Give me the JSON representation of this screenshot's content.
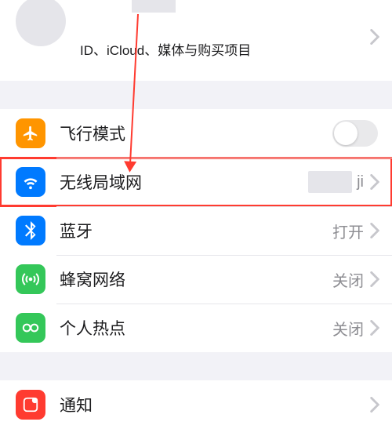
{
  "profile": {
    "subtitle": "ID、iCloud、媒体与购买项目"
  },
  "icons": {
    "airplane": "airplane-icon",
    "wifi": "wifi-icon",
    "bluetooth": "bluetooth-icon",
    "cellular": "cellular-icon",
    "hotspot": "hotspot-icon",
    "notifications": "notifications-icon"
  },
  "colors": {
    "orange": "#ff9500",
    "blue": "#007aff",
    "green": "#34c759",
    "red": "#ff3b30"
  },
  "rows": {
    "airplane": {
      "label": "飞行模式"
    },
    "wifi": {
      "label": "无线局域网",
      "value": "ji"
    },
    "bluetooth": {
      "label": "蓝牙",
      "value": "打开"
    },
    "cellular": {
      "label": "蜂窝网络",
      "value": "关闭"
    },
    "hotspot": {
      "label": "个人热点",
      "value": "关闭"
    },
    "notifications": {
      "label": "通知"
    }
  }
}
